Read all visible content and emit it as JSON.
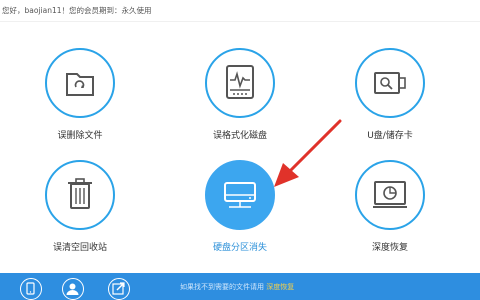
{
  "header": {
    "greeting": "您好，baojian11！您的会员期到：永久使用"
  },
  "tiles": [
    {
      "label": "误删除文件",
      "icon": "recycle-folder-icon"
    },
    {
      "label": "误格式化磁盘",
      "icon": "disk-pulse-icon"
    },
    {
      "label": "U盘/储存卡",
      "icon": "usb-search-icon"
    },
    {
      "label": "误清空回收站",
      "icon": "trash-bin-icon"
    },
    {
      "label": "硬盘分区消失",
      "icon": "hard-drive-icon"
    },
    {
      "label": "深度恢复",
      "icon": "monitor-scan-icon"
    }
  ],
  "footer": {
    "text_main": "如果找不到需要的文件请用",
    "text_highlight": "深度恢复"
  },
  "colors": {
    "accent": "#2aa3e8",
    "active": "#3ca6ef",
    "footer_bg": "#2e8ee0",
    "arrow": "#e0322a"
  }
}
